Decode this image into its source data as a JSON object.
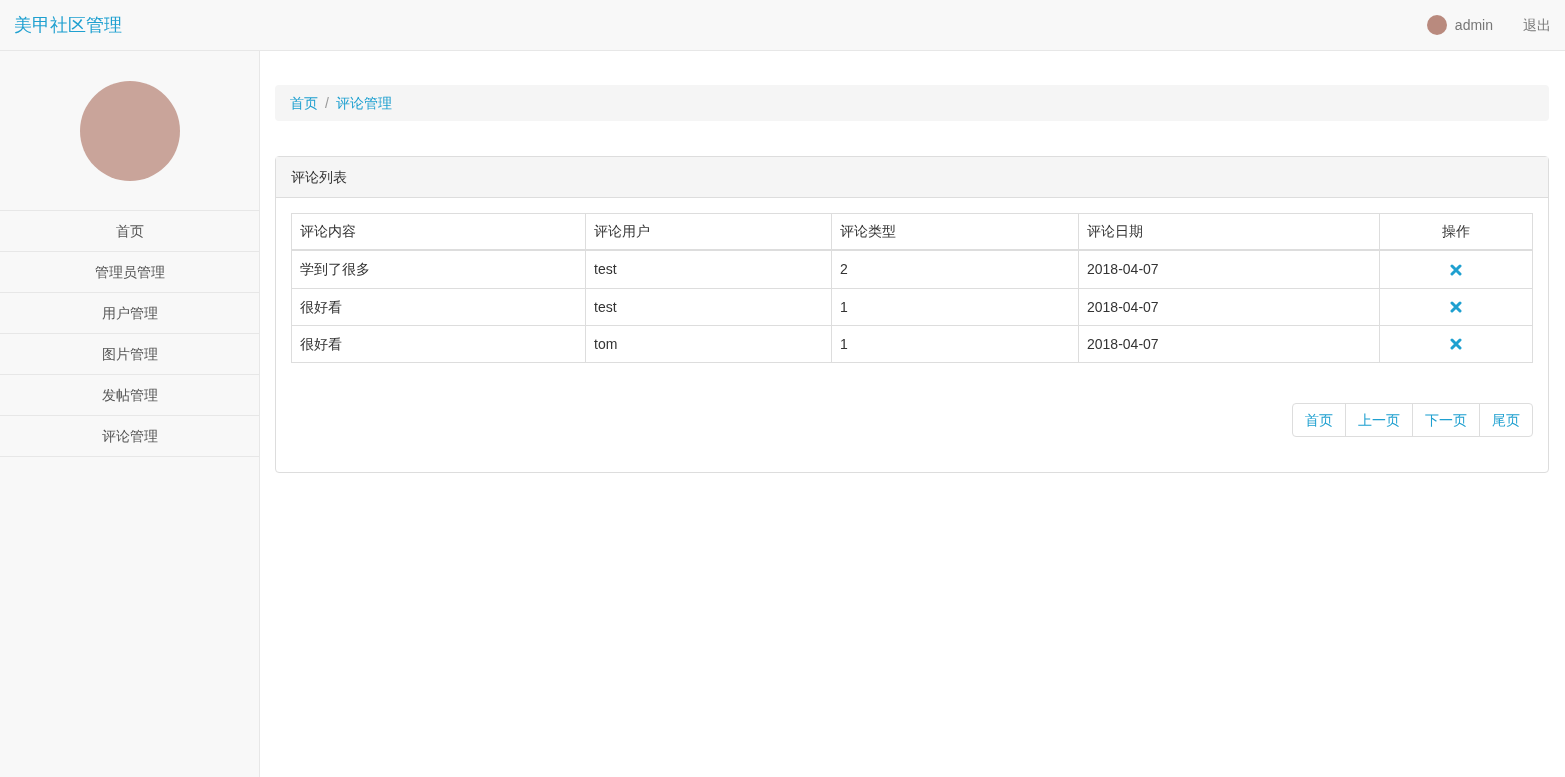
{
  "header": {
    "brand": "美甲社区管理",
    "user": "admin",
    "logout": "退出"
  },
  "sidebar": {
    "items": [
      {
        "label": "首页"
      },
      {
        "label": "管理员管理"
      },
      {
        "label": "用户管理"
      },
      {
        "label": "图片管理"
      },
      {
        "label": "发帖管理"
      },
      {
        "label": "评论管理"
      }
    ]
  },
  "breadcrumb_separator": "/",
  "breadcrumb": [
    {
      "label": "首页"
    },
    {
      "label": "评论管理"
    }
  ],
  "panel": {
    "title": "评论列表",
    "table": {
      "columns": [
        "评论内容",
        "评论用户",
        "评论类型",
        "评论日期",
        "操作"
      ],
      "rows": [
        [
          "学到了很多",
          "test",
          "2",
          "2018-04-07"
        ],
        [
          "很好看",
          "test",
          "1",
          "2018-04-07"
        ],
        [
          "很好看",
          "tom",
          "1",
          "2018-04-07"
        ]
      ]
    },
    "pagination": [
      "首页",
      "上一页",
      "下一页",
      "尾页"
    ]
  }
}
